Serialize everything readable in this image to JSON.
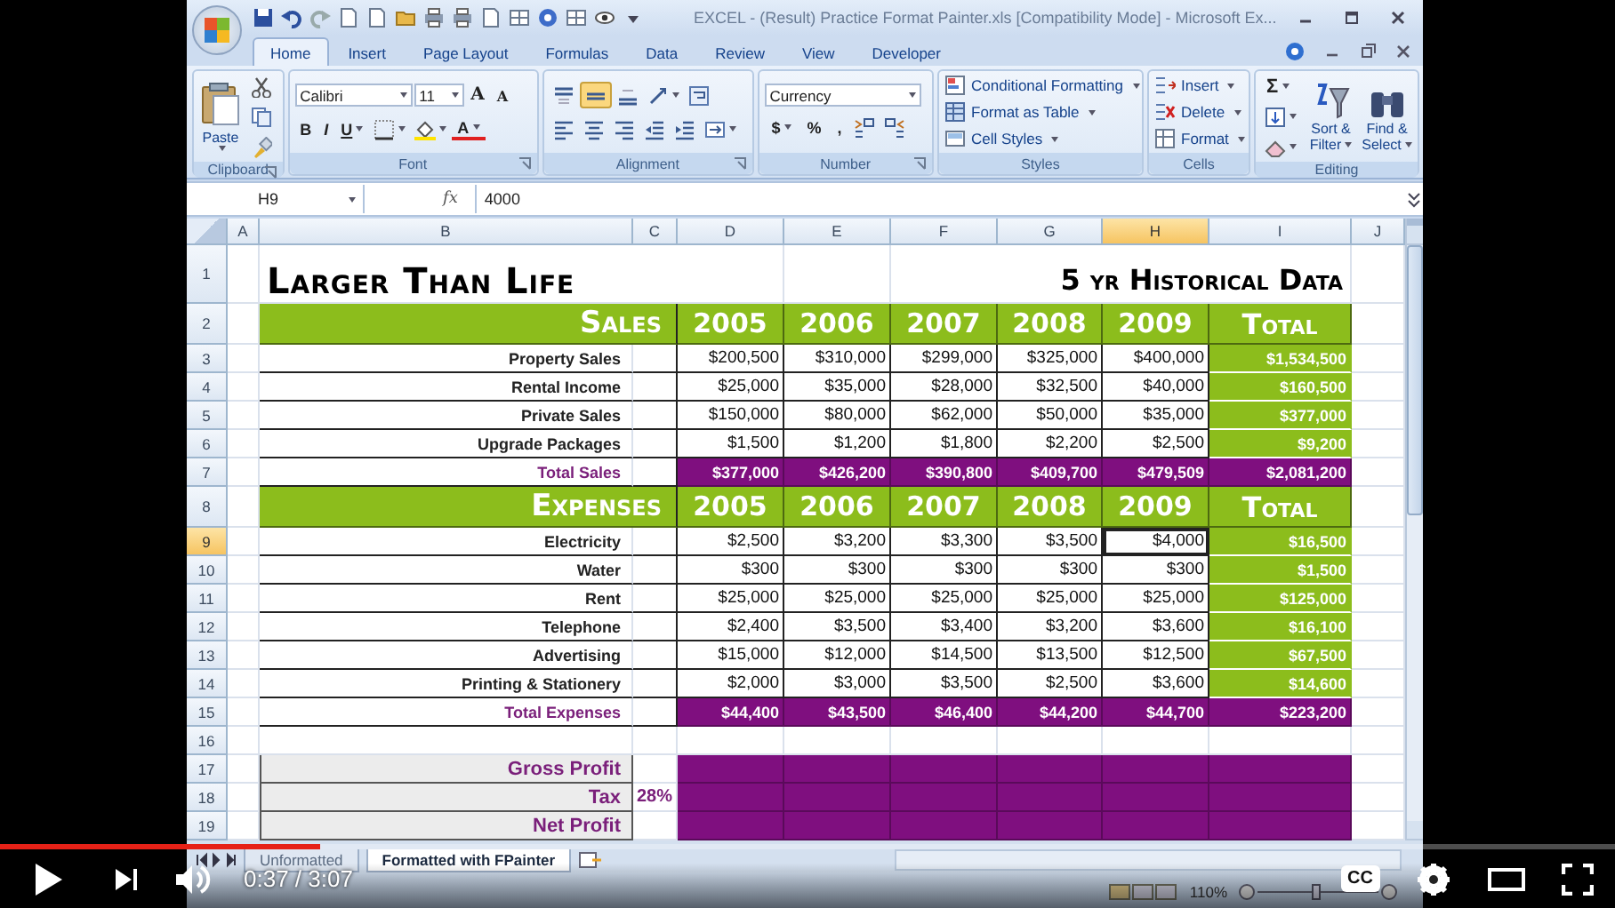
{
  "window": {
    "title": "EXCEL - (Result) Practice Format Painter.xls  [Compatibility Mode] - Microsoft Ex..."
  },
  "ribbon": {
    "tabs": [
      {
        "label": "Home",
        "selected": true
      },
      {
        "label": "Insert",
        "selected": false
      },
      {
        "label": "Page Layout",
        "selected": false
      },
      {
        "label": "Formulas",
        "selected": false
      },
      {
        "label": "Data",
        "selected": false
      },
      {
        "label": "Review",
        "selected": false
      },
      {
        "label": "View",
        "selected": false
      },
      {
        "label": "Developer",
        "selected": false
      }
    ],
    "groups": [
      {
        "kind": "clipboard",
        "label": "Clipboard",
        "launcher": true,
        "paste_label": "Paste"
      },
      {
        "kind": "font",
        "label": "Font",
        "launcher": true,
        "font_name": "Calibri",
        "font_size": "11",
        "grow": "A",
        "shrink": "A",
        "styles": [
          "B",
          "I",
          "U"
        ],
        "font_color": "A"
      },
      {
        "kind": "alignment",
        "label": "Alignment",
        "launcher": true,
        "vertical_align": [
          {
            "selected": false
          },
          {
            "selected": true
          },
          {
            "selected": false
          }
        ]
      },
      {
        "kind": "number",
        "label": "Number",
        "launcher": true,
        "format": "Currency",
        "symbols": [
          "$",
          "%",
          ","
        ]
      },
      {
        "kind": "styles",
        "label": "Styles",
        "launcher": false,
        "commands": [
          "Conditional Formatting",
          "Format as Table",
          "Cell Styles"
        ]
      },
      {
        "kind": "cells",
        "label": "Cells",
        "launcher": false,
        "commands": [
          "Insert",
          "Delete",
          "Format"
        ]
      },
      {
        "kind": "editing",
        "label": "Editing",
        "launcher": false,
        "sum": "Σ",
        "commands": [
          "Sort & Filter",
          "Find & Select"
        ]
      }
    ]
  },
  "formula_bar": {
    "name_box": "H9",
    "function_label": "fx",
    "formula": "4000"
  },
  "sheet": {
    "columns": [
      {
        "label": "A",
        "selected": false
      },
      {
        "label": "B",
        "selected": false
      },
      {
        "label": "C",
        "selected": false
      },
      {
        "label": "D",
        "selected": false
      },
      {
        "label": "E",
        "selected": false
      },
      {
        "label": "F",
        "selected": false
      },
      {
        "label": "G",
        "selected": false
      },
      {
        "label": "H",
        "selected": true
      },
      {
        "label": "I",
        "selected": false
      },
      {
        "label": "J",
        "selected": false
      }
    ],
    "rows": [
      {
        "number": "1",
        "selected": false,
        "kind": "title",
        "label": "Larger Than Life",
        "title_right": "5 yr Historical Data"
      },
      {
        "number": "2",
        "selected": false,
        "kind": "header",
        "label": "Sales",
        "values": [
          "2005",
          "2006",
          "2007",
          "2008",
          "2009"
        ],
        "total": "Total"
      },
      {
        "number": "3",
        "selected": false,
        "kind": "item",
        "label": "Property Sales",
        "values": [
          "$200,500",
          "$310,000",
          "$299,000",
          "$325,000",
          "$400,000"
        ],
        "total": "$1,534,500"
      },
      {
        "number": "4",
        "selected": false,
        "kind": "item",
        "label": "Rental Income",
        "values": [
          "$25,000",
          "$35,000",
          "$28,000",
          "$32,500",
          "$40,000"
        ],
        "total": "$160,500"
      },
      {
        "number": "5",
        "selected": false,
        "kind": "item",
        "label": "Private Sales",
        "values": [
          "$150,000",
          "$80,000",
          "$62,000",
          "$50,000",
          "$35,000"
        ],
        "total": "$377,000"
      },
      {
        "number": "6",
        "selected": false,
        "kind": "item",
        "label": "Upgrade Packages",
        "values": [
          "$1,500",
          "$1,200",
          "$1,800",
          "$2,200",
          "$2,500"
        ],
        "total": "$9,200"
      },
      {
        "number": "7",
        "selected": false,
        "kind": "sum",
        "label": "Total Sales",
        "values": [
          "$377,000",
          "$426,200",
          "$390,800",
          "$409,700",
          "$479,509"
        ],
        "total": "$2,081,200"
      },
      {
        "number": "8",
        "selected": false,
        "kind": "header",
        "label": "Expenses",
        "values": [
          "2005",
          "2006",
          "2007",
          "2008",
          "2009"
        ],
        "total": "Total"
      },
      {
        "number": "9",
        "selected": true,
        "kind": "item",
        "label": "Electricity",
        "values": [
          "$2,500",
          "$3,200",
          "$3,300",
          "$3,500",
          "$4,000"
        ],
        "total": "$16,500"
      },
      {
        "number": "10",
        "selected": false,
        "kind": "item",
        "label": "Water",
        "values": [
          "$300",
          "$300",
          "$300",
          "$300",
          "$300"
        ],
        "total": "$1,500"
      },
      {
        "number": "11",
        "selected": false,
        "kind": "item",
        "label": "Rent",
        "values": [
          "$25,000",
          "$25,000",
          "$25,000",
          "$25,000",
          "$25,000"
        ],
        "total": "$125,000"
      },
      {
        "number": "12",
        "selected": false,
        "kind": "item",
        "label": "Telephone",
        "values": [
          "$2,400",
          "$3,500",
          "$3,400",
          "$3,200",
          "$3,600"
        ],
        "total": "$16,100"
      },
      {
        "number": "13",
        "selected": false,
        "kind": "item",
        "label": "Advertising",
        "values": [
          "$15,000",
          "$12,000",
          "$14,500",
          "$13,500",
          "$12,500"
        ],
        "total": "$67,500"
      },
      {
        "number": "14",
        "selected": false,
        "kind": "item",
        "label": "Printing & Stationery",
        "values": [
          "$2,000",
          "$3,000",
          "$3,500",
          "$2,500",
          "$3,600"
        ],
        "total": "$14,600"
      },
      {
        "number": "15",
        "selected": false,
        "kind": "sum",
        "label": "Total Expenses",
        "values": [
          "$44,400",
          "$43,500",
          "$46,400",
          "$44,200",
          "$44,700"
        ],
        "total": "$223,200"
      },
      {
        "number": "16",
        "selected": false,
        "kind": "blank"
      },
      {
        "number": "17",
        "selected": false,
        "kind": "profit",
        "label": "Gross Profit"
      },
      {
        "number": "18",
        "selected": false,
        "kind": "profit",
        "label": "Tax",
        "rate": "28%"
      },
      {
        "number": "19",
        "selected": false,
        "kind": "profit",
        "label": "Net Profit"
      }
    ]
  },
  "sheet_tabs": [
    {
      "label": "Unformatted",
      "selected": false
    },
    {
      "label": "Formatted with FPainter",
      "selected": true
    }
  ],
  "status_bar": {
    "zoom": "110%"
  },
  "player": {
    "progress": {
      "level": 0.198
    },
    "time": "0:37 / 3:07",
    "captions_label": "CC"
  }
}
